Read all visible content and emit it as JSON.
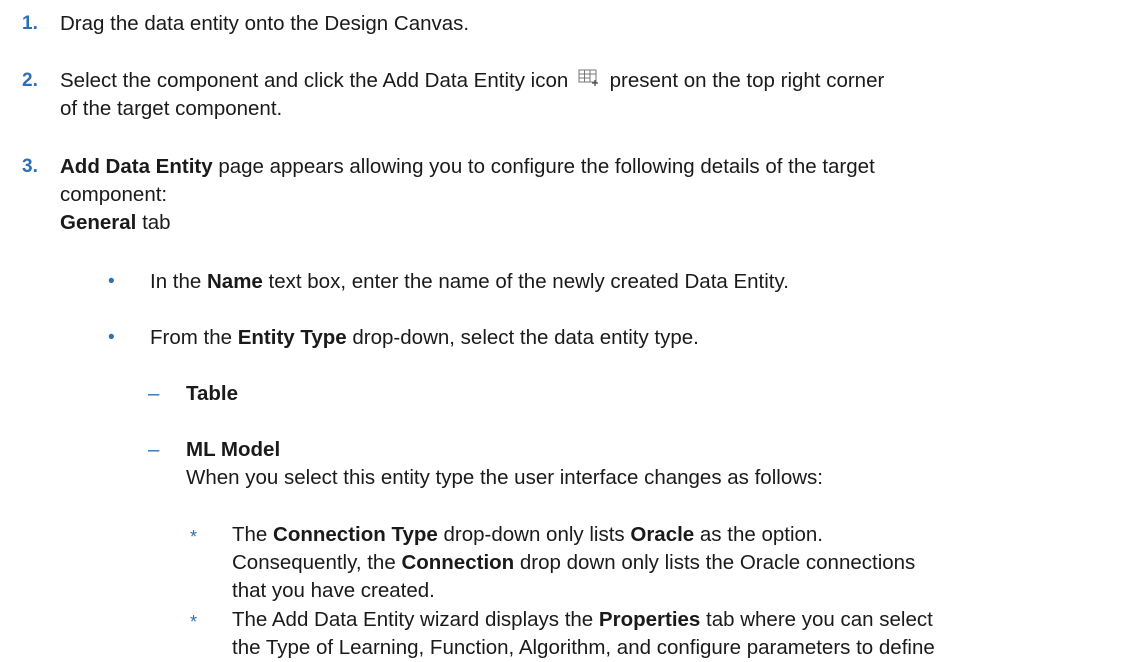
{
  "steps": [
    {
      "num": "1.",
      "text": "Drag the data entity onto the Design Canvas."
    },
    {
      "num": "2.",
      "text_before": "Select the component and click the Add Data Entity icon",
      "text_after": "present on the top right corner",
      "text_line2": "of the target component.",
      "icon": "add-data-entity-icon"
    },
    {
      "num": "3.",
      "bold": "Add Data Entity",
      "line1": "page appears allowing you to configure the following details of the target",
      "line2": "component:",
      "tab_bold": "General",
      "tab_rest": "tab"
    }
  ],
  "bullets": [
    {
      "pre": "In the",
      "bold": "Name",
      "post": "text box, enter the name of the newly created Data Entity."
    },
    {
      "pre": "From the",
      "bold": "Entity Type",
      "post": "drop-down, select the data entity type."
    }
  ],
  "entity_types": {
    "table": "Table",
    "ml_model": "ML Model",
    "ml_model_desc": "When you select this entity type the user interface changes as follows:"
  },
  "sub_items": [
    {
      "line1_pre": "The",
      "line1_bold": "Connection Type",
      "line1_mid": "drop-down only lists",
      "line1_bold2": "Oracle",
      "line1_post": "as the option.",
      "line2_pre": "Consequently, the",
      "line2_bold": "Connection",
      "line2_post": "drop down only lists the Oracle connections",
      "line3": "that you have created."
    },
    {
      "line1_pre": "The Add Data Entity wizard displays the",
      "line1_bold": "Properties",
      "line1_post": "tab where you can select",
      "line2": "the Type of Learning, Function, Algorithm, and configure parameters to define"
    }
  ],
  "markers": {
    "bullet": "•",
    "dash": "–",
    "star": "*"
  }
}
